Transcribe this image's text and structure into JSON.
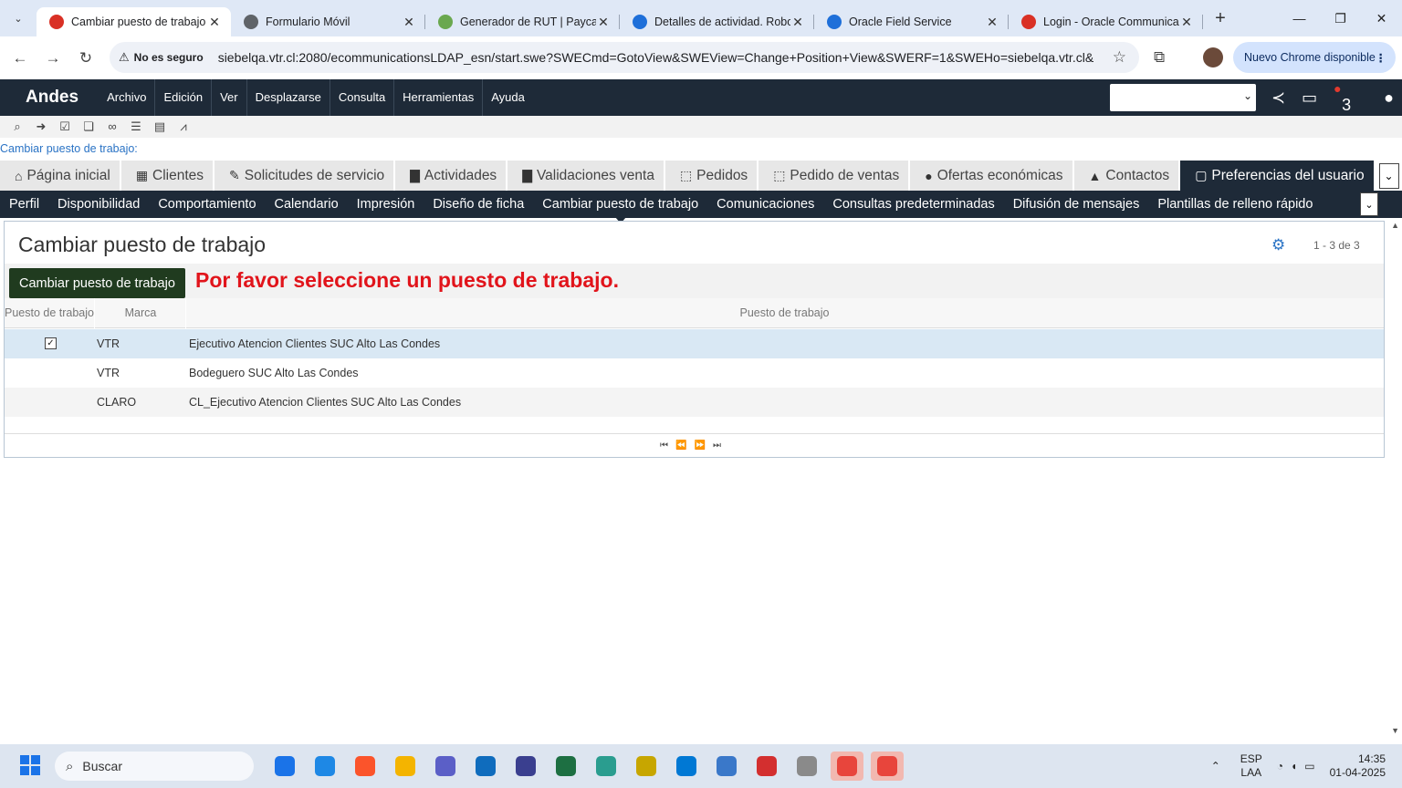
{
  "browser": {
    "tabs": [
      {
        "title": "Cambiar puesto de trabajo",
        "color": "#d93025",
        "active": true
      },
      {
        "title": "Formulario Móvil",
        "color": "#5f6368",
        "active": false
      },
      {
        "title": "Generador de RUT | Payca",
        "color": "#6aa84f",
        "active": false
      },
      {
        "title": "Detalles de actividad. Robo",
        "color": "#1e6fd9",
        "active": false
      },
      {
        "title": "Oracle Field Service",
        "color": "#1e6fd9",
        "active": false
      },
      {
        "title": "Login - Oracle Communica",
        "color": "#d93025",
        "active": false
      }
    ],
    "security": "No es seguro",
    "url": "siebelqa.vtr.cl:2080/ecommunicationsLDAP_esn/start.swe?SWECmd=GotoView&SWEView=Change+Position+View&SWERF=1&SWEHo=siebelqa.vtr.cl&S...",
    "update_button": "Nuevo Chrome disponible"
  },
  "app": {
    "brand": "Andes",
    "menu": [
      "Archivo",
      "Edición",
      "Ver",
      "Desplazarse",
      "Consulta",
      "Herramientas",
      "Ayuda"
    ],
    "notification_count": "3",
    "breadcrumb": "Cambiar puesto de trabajo:",
    "screen_tabs": [
      {
        "label": "Página inicial",
        "icon": "home-icon",
        "glyph": "⌂"
      },
      {
        "label": "Clientes",
        "icon": "building-icon",
        "glyph": "▦"
      },
      {
        "label": "Solicitudes de servicio",
        "icon": "wrench-icon",
        "glyph": "✎"
      },
      {
        "label": "Actividades",
        "icon": "calendar-icon",
        "glyph": "▇"
      },
      {
        "label": "Validaciones venta",
        "icon": "calendar-icon",
        "glyph": "▇"
      },
      {
        "label": "Pedidos",
        "icon": "box-icon",
        "glyph": "⬚"
      },
      {
        "label": "Pedido de ventas",
        "icon": "box-icon",
        "glyph": "⬚"
      },
      {
        "label": "Ofertas económicas",
        "icon": "dollar-icon",
        "glyph": "●"
      },
      {
        "label": "Contactos",
        "icon": "person-icon",
        "glyph": "▲"
      },
      {
        "label": "Preferencias del usuario",
        "icon": "page-icon",
        "glyph": "▢"
      }
    ],
    "view_tabs": [
      "Perfil",
      "Disponibilidad",
      "Comportamiento",
      "Calendario",
      "Impresión",
      "Diseño de ficha",
      "Cambiar puesto de trabajo",
      "Comunicaciones",
      "Consultas predeterminadas",
      "Difusión de mensajes",
      "Plantillas de relleno rápido"
    ],
    "active_view_tab": 6
  },
  "applet": {
    "title": "Cambiar puesto de trabajo",
    "record_count": "1 - 3 de 3",
    "button": "Cambiar puesto de trabajo",
    "message": "Por favor seleccione un puesto de trabajo.",
    "columns": [
      "Puesto de trabajo",
      "Marca",
      "Puesto de trabajo"
    ],
    "rows": [
      {
        "primary": true,
        "marca": "VTR",
        "puesto": "Ejecutivo Atencion Clientes SUC Alto Las Condes"
      },
      {
        "primary": false,
        "marca": "VTR",
        "puesto": "Bodeguero SUC Alto Las Condes"
      },
      {
        "primary": false,
        "marca": "CLARO",
        "puesto": "CL_Ejecutivo Atencion Clientes SUC Alto Las Condes"
      }
    ]
  },
  "taskbar": {
    "search_placeholder": "Buscar",
    "lang": "ESP",
    "layout": "LAA",
    "time": "14:35",
    "date": "01-04-2025",
    "apps": [
      "#1a73e8",
      "#1e88e5",
      "#fb542b",
      "#f4b400",
      "#5b5fc7",
      "#0f6cbd",
      "#3a3f8f",
      "#1d6f42",
      "#2a9d8f",
      "#c7a600",
      "#0078d4",
      "#3a78c9",
      "#d32f2f",
      "#8a8a8a",
      "#e8453c",
      "#e8453c"
    ]
  }
}
